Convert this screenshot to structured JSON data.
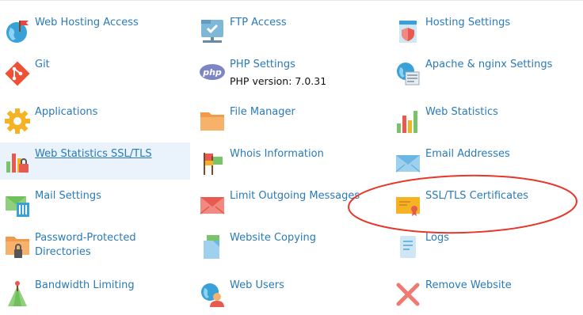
{
  "items": {
    "web_hosting_access": "Web Hosting Access",
    "ftp_access": "FTP Access",
    "hosting_settings": "Hosting Settings",
    "git": "Git",
    "php_settings": "PHP Settings",
    "php_version": "PHP version: 7.0.31",
    "apache_nginx": "Apache & nginx Settings",
    "applications": "Applications",
    "file_manager": "File Manager",
    "web_statistics": "Web Statistics",
    "web_statistics_ssl": "Web Statistics SSL/TLS",
    "whois_information": "Whois Information",
    "email_addresses": "Email Addresses",
    "mail_settings": "Mail Settings",
    "limit_outgoing": "Limit Outgoing Messages",
    "ssl_certificates": "SSL/TLS Certificates",
    "password_protected": "Password-Protected",
    "password_protected_2": "Directories",
    "website_copying": "Website Copying",
    "logs": "Logs",
    "bandwidth_limiting": "Bandwidth Limiting",
    "web_users": "Web Users",
    "remove_website": "Remove Website"
  },
  "icons": {
    "web_hosting_access": "globe-flag-icon",
    "ftp_access": "ftp-folder-icon",
    "hosting_settings": "hosting-settings-icon",
    "git": "git-icon",
    "php_settings": "php-icon",
    "apache_nginx": "apache-nginx-icon",
    "applications": "gear-icon",
    "file_manager": "folder-icon",
    "web_statistics": "bar-chart-icon",
    "web_statistics_ssl": "bar-chart-lock-icon",
    "whois_information": "whois-flags-icon",
    "email_addresses": "envelope-icon",
    "mail_settings": "mail-settings-icon",
    "limit_outgoing": "envelope-limit-icon",
    "ssl_certificates": "certificate-icon",
    "password_protected": "locked-folder-icon",
    "website_copying": "copy-pages-icon",
    "logs": "log-document-icon",
    "bandwidth_limiting": "bandwidth-icon",
    "web_users": "web-user-icon",
    "remove_website": "remove-x-icon"
  },
  "colors": {
    "link": "#2a7ab8",
    "highlight_bg": "#eaf3fb",
    "annotation_circle": "#e8362c"
  }
}
